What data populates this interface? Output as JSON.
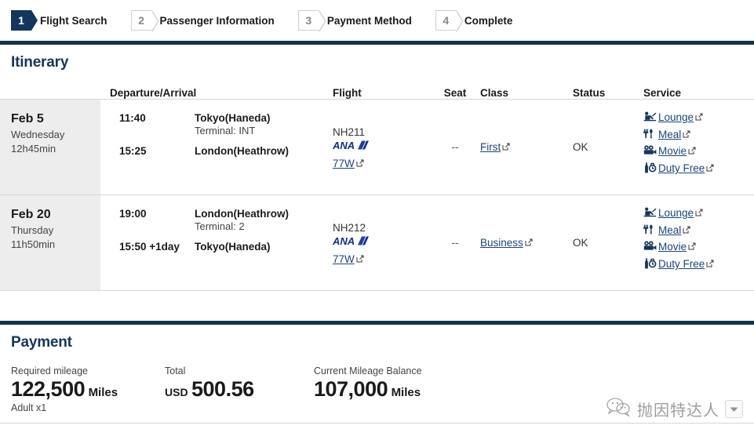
{
  "steps": [
    {
      "num": "1",
      "label": "Flight Search",
      "state": "active"
    },
    {
      "num": "2",
      "label": "Passenger Information",
      "state": "idle"
    },
    {
      "num": "3",
      "label": "Payment Method",
      "state": "idle"
    },
    {
      "num": "4",
      "label": "Complete",
      "state": "idle"
    }
  ],
  "itinerary": {
    "title": "Itinerary",
    "columns": {
      "date": "",
      "departure_arrival": "Departure/Arrival",
      "flight": "Flight",
      "seat": "Seat",
      "class": "Class",
      "status": "Status",
      "service": "Service"
    },
    "rows": [
      {
        "date_main": "Feb 5",
        "date_weekday": "Wednesday",
        "duration": "12h45min",
        "dep_time": "11:40",
        "dep_place": "Tokyo(Haneda)",
        "terminal": "Terminal: INT",
        "arr_time": "15:25",
        "arr_place": "London(Heathrow)",
        "flight_no": "NH211",
        "carrier": "ANA",
        "aircraft": "77W",
        "seat": "--",
        "cabin_class": "First",
        "status": "OK",
        "services": [
          {
            "icon": "lounge-icon",
            "label": "Lounge"
          },
          {
            "icon": "meal-icon",
            "label": "Meal"
          },
          {
            "icon": "movie-icon",
            "label": "Movie"
          },
          {
            "icon": "duty-free-icon",
            "label": "Duty Free"
          }
        ]
      },
      {
        "date_main": "Feb 20",
        "date_weekday": "Thursday",
        "duration": "11h50min",
        "dep_time": "19:00",
        "dep_place": "London(Heathrow)",
        "terminal": "Terminal: 2",
        "arr_time": "15:50 +1day",
        "arr_place": "Tokyo(Haneda)",
        "flight_no": "NH212",
        "carrier": "ANA",
        "aircraft": "77W",
        "seat": "--",
        "cabin_class": "Business",
        "status": "OK",
        "services": [
          {
            "icon": "lounge-icon",
            "label": "Lounge"
          },
          {
            "icon": "meal-icon",
            "label": "Meal"
          },
          {
            "icon": "movie-icon",
            "label": "Movie"
          },
          {
            "icon": "duty-free-icon",
            "label": "Duty Free"
          }
        ]
      }
    ]
  },
  "payment": {
    "title": "Payment",
    "required_mileage": {
      "label": "Required mileage",
      "amount": "122,500",
      "unit": "Miles",
      "note": "Adult x1"
    },
    "total": {
      "label": "Total",
      "currency": "USD",
      "amount": "500.56"
    },
    "balance": {
      "label": "Current Mileage Balance",
      "amount": "107,000",
      "unit": "Miles"
    }
  },
  "watermark": {
    "text": "抛因特达人",
    "logo": "wechat-icon",
    "dropdown": "chevron-down-icon"
  },
  "colors": {
    "navy_rule": "#13344e",
    "heading": "#13365c",
    "link": "#19457e",
    "row_date_bg": "#ededed",
    "ana_blue": "#0d2f8c"
  }
}
